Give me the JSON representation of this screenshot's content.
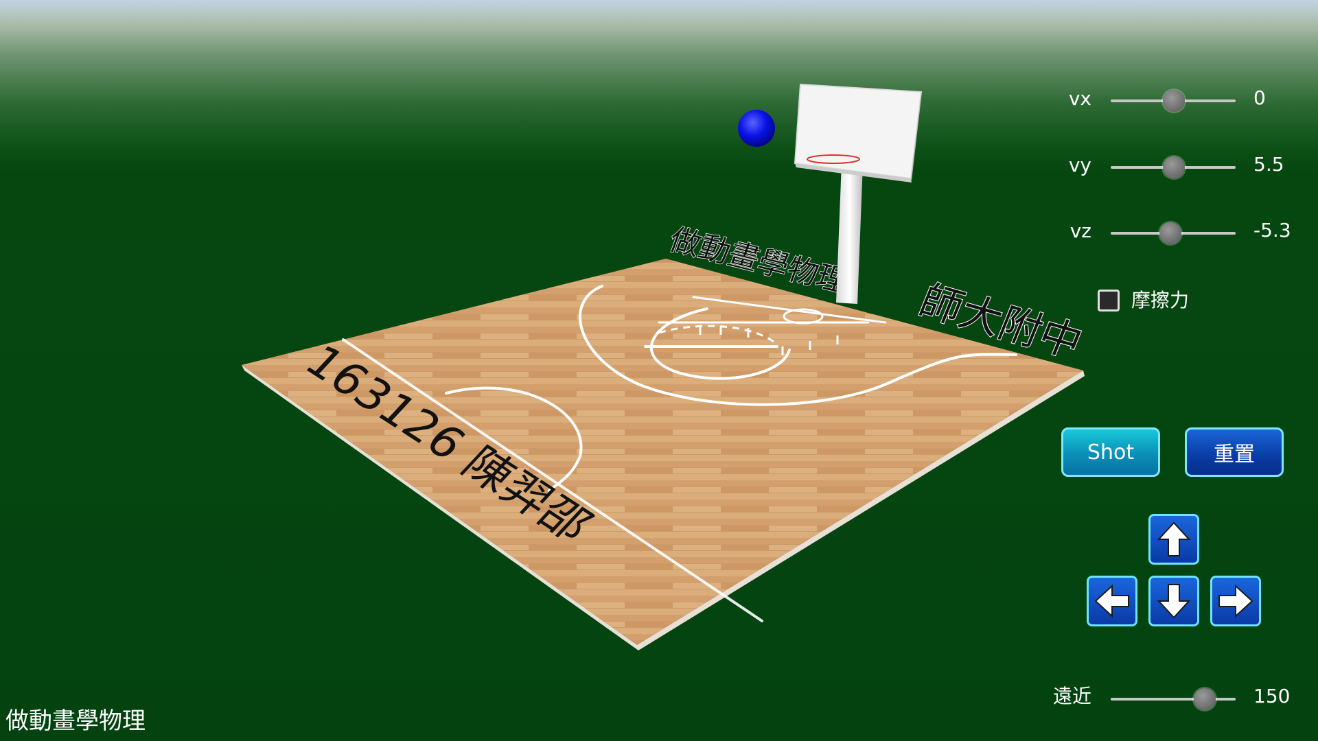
{
  "scene": {
    "court_text_near": "163126 陳羿邵",
    "court_text_far": "做動畫學物理",
    "court_text_right": "師大附中"
  },
  "controls": {
    "vx": {
      "label": "vx",
      "value": "0"
    },
    "vy": {
      "label": "vy",
      "value": "5.5"
    },
    "vz": {
      "label": "vz",
      "value": "-5.3"
    },
    "friction": {
      "label": "摩擦力",
      "checked": false
    },
    "shot_label": "Shot",
    "reset_label": "重置",
    "distance": {
      "label": "遠近",
      "value": "150"
    }
  },
  "footer": {
    "title": "做動畫學物理"
  },
  "icons": {
    "up": "arrow-up-icon",
    "down": "arrow-down-icon",
    "left": "arrow-left-icon",
    "right": "arrow-right-icon"
  },
  "colors": {
    "background_green": "#044310",
    "ball": "#0a12e6",
    "shot_button": "#0a8fb8",
    "reset_button": "#0a3ea8",
    "court_wood": "#d8a877"
  }
}
